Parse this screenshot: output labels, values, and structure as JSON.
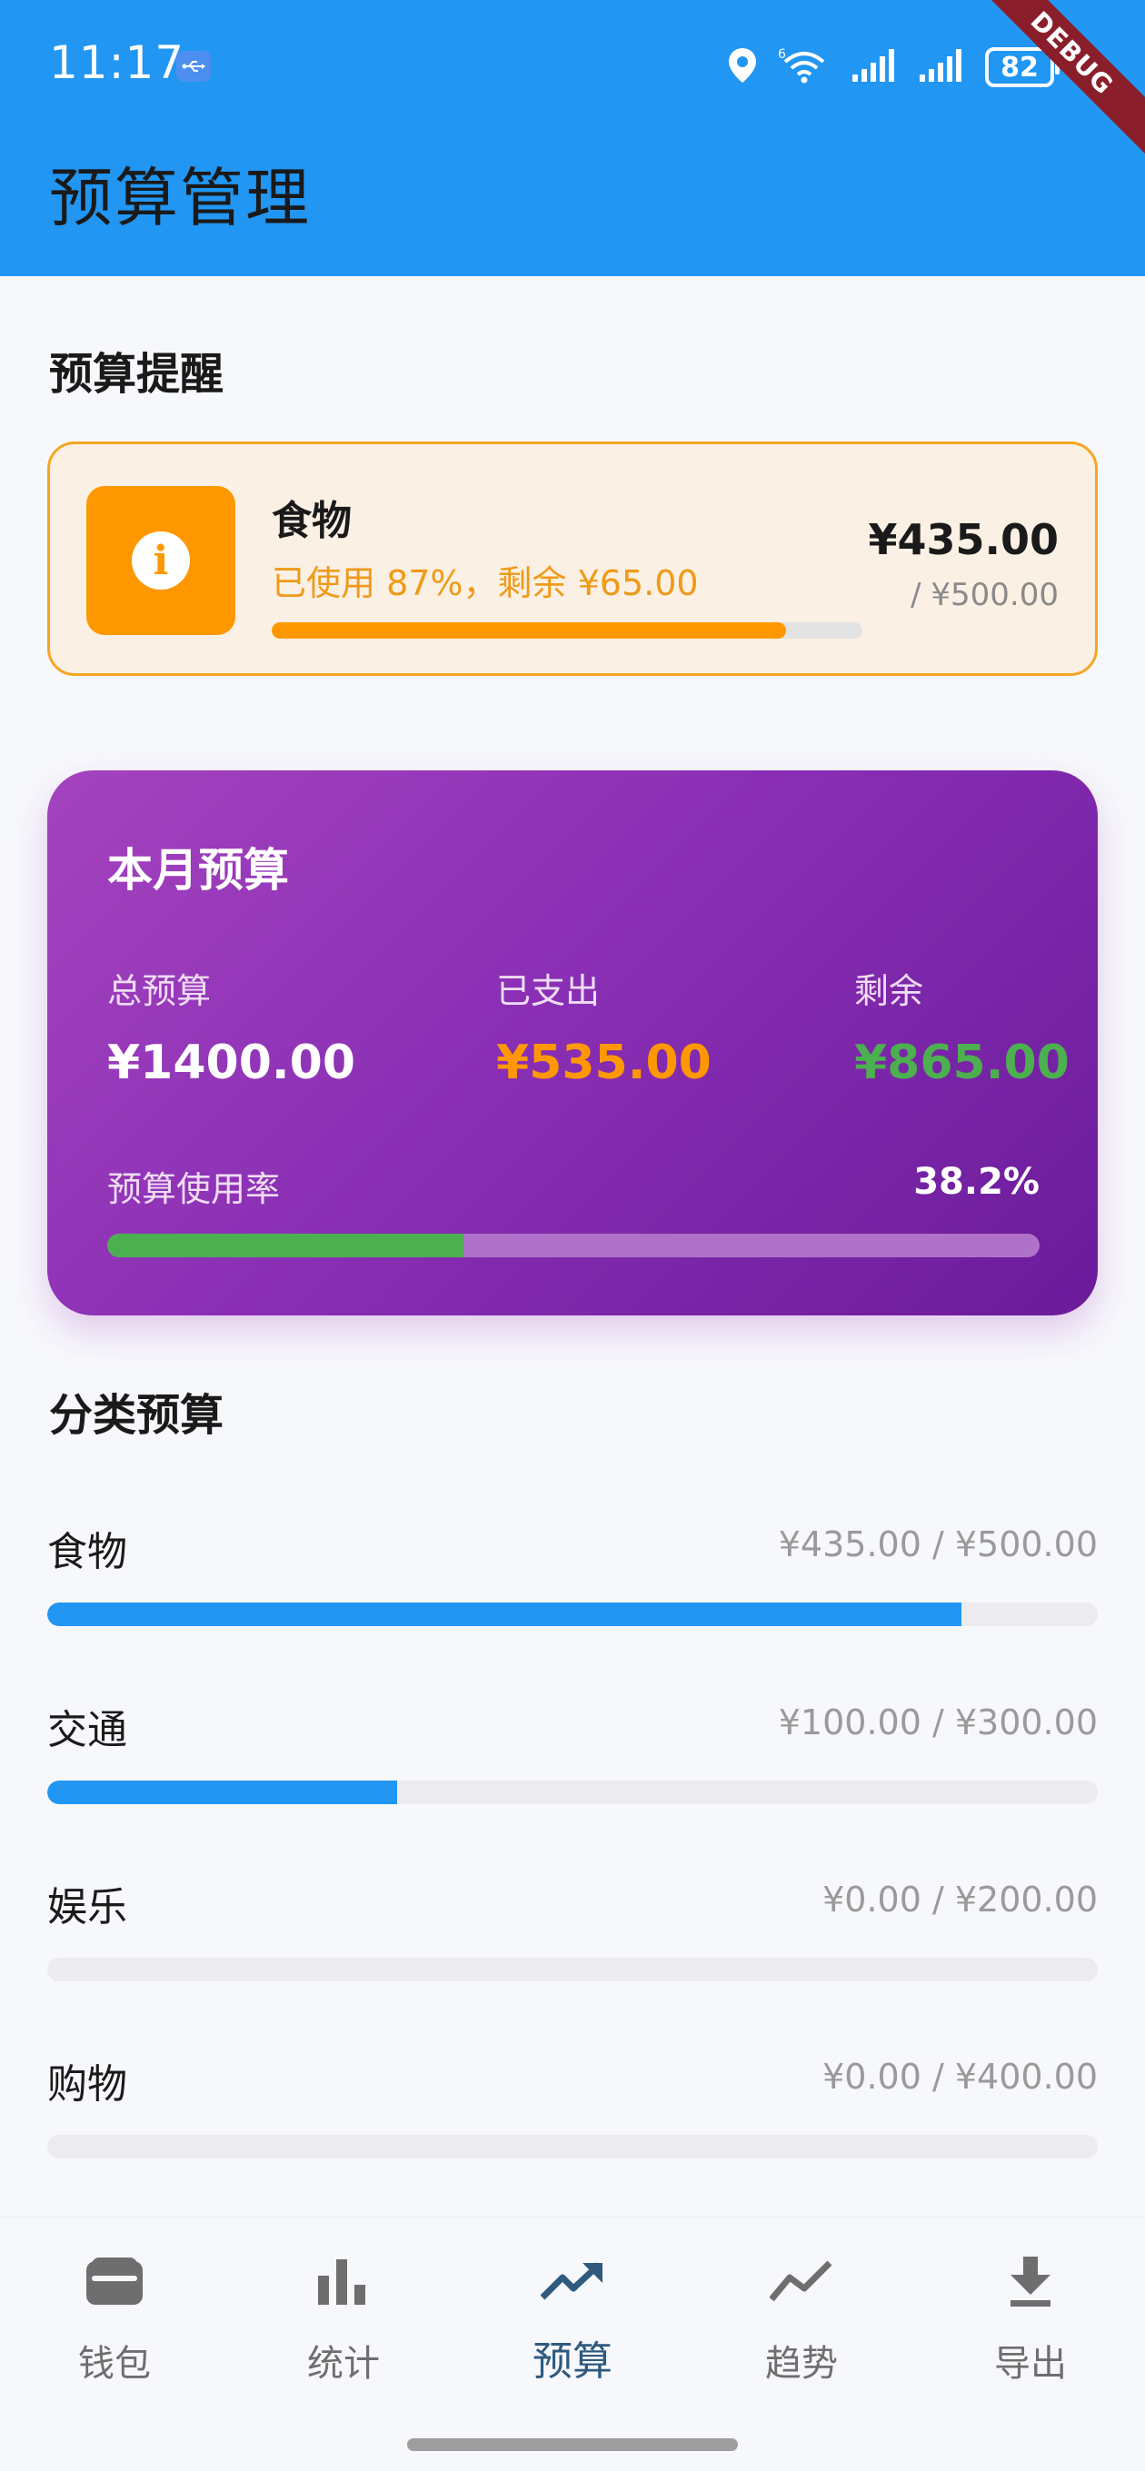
{
  "status_bar": {
    "time": "11:17",
    "battery": "82",
    "debug_label": "DEBUG"
  },
  "app_bar": {
    "title": "预算管理"
  },
  "alerts": {
    "section_title": "预算提醒",
    "items": [
      {
        "category": "食物",
        "message": "已使用 87%，剩余 ¥65.00",
        "spent": "¥435.00",
        "limit": "/ ¥500.00",
        "usage_fraction": 0.87,
        "icon": "info-icon"
      }
    ]
  },
  "monthly": {
    "title": "本月预算",
    "total_label": "总预算",
    "total_value": "¥1400.00",
    "spent_label": "已支出",
    "spent_value": "¥535.00",
    "remaining_label": "剩余",
    "remaining_value": "¥865.00",
    "usage_label": "预算使用率",
    "usage_text": "38.2%",
    "usage_fraction": 0.382
  },
  "categories": {
    "section_title": "分类预算",
    "items": [
      {
        "name": "食物",
        "amount": "¥435.00 / ¥500.00",
        "fraction": 0.87
      },
      {
        "name": "交通",
        "amount": "¥100.00 / ¥300.00",
        "fraction": 0.333
      },
      {
        "name": "娱乐",
        "amount": "¥0.00 / ¥200.00",
        "fraction": 0
      },
      {
        "name": "购物",
        "amount": "¥0.00 / ¥400.00",
        "fraction": 0
      }
    ]
  },
  "bottom_nav": {
    "items": [
      {
        "label": "钱包",
        "icon": "wallet-icon",
        "active": false
      },
      {
        "label": "统计",
        "icon": "bar-chart-icon",
        "active": false
      },
      {
        "label": "预算",
        "icon": "trending-up-icon",
        "active": true
      },
      {
        "label": "趋势",
        "icon": "show-chart-icon",
        "active": false
      },
      {
        "label": "导出",
        "icon": "download-icon",
        "active": false
      }
    ]
  },
  "colors": {
    "primary": "#2196f3",
    "warning": "#ff9800",
    "spent": "#ff9800",
    "remaining": "#4caf50",
    "card_gradient_start": "#a443be",
    "card_gradient_end": "#6a1b9a",
    "nav_active": "#2f5a7e"
  }
}
